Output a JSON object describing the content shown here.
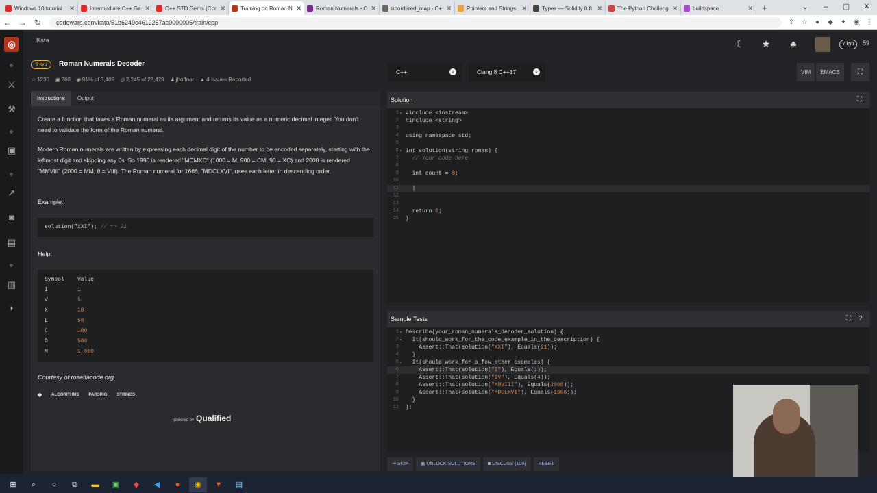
{
  "browser": {
    "tabs": [
      {
        "label": "Windows 10 tutorial",
        "fav_color": "#e02828"
      },
      {
        "label": "Intermediate C++ Ga",
        "fav_color": "#e02828"
      },
      {
        "label": "C++ STD Gems (Cor",
        "fav_color": "#e02828"
      },
      {
        "label": "Training on Roman N",
        "fav_color": "#b1361e",
        "active": true
      },
      {
        "label": "Roman Numerals - O",
        "fav_color": "#7a2a8a"
      },
      {
        "label": "unordered_map - C+",
        "fav_color": "#666"
      },
      {
        "label": "Pointers and Strings",
        "fav_color": "#e9a23b"
      },
      {
        "label": "Types — Solidity 0.8",
        "fav_color": "#444"
      },
      {
        "label": "The Python Challeng",
        "fav_color": "#c44"
      },
      {
        "label": "buildspace",
        "fav_color": "#a64ad0"
      }
    ],
    "new_tab": "+",
    "url": "codewars.com/kata/51b6249c4612257ac0000005/train/cpp"
  },
  "header": {
    "section": "Kata",
    "honor": "59",
    "user_rank": "7 kyu"
  },
  "kata": {
    "rank": "6 kyu",
    "title": "Roman Numerals Decoder",
    "stats": {
      "stars": "1230",
      "collections": "260",
      "satisfaction": "91% of 3,409",
      "completed": "2,245 of 28,479",
      "author": "jhoffner",
      "issues": "4 Issues Reported"
    }
  },
  "description": {
    "tabs": [
      "Instructions",
      "Output"
    ],
    "para1": "Create a function that takes a Roman numeral as its argument and returns its value as a numeric decimal integer. You don't need to validate the form of the Roman numeral.",
    "para2": "Modern Roman numerals are written by expressing each decimal digit of the number to be encoded separately, starting with the leftmost digit and skipping any 0s. So 1990 is rendered \"MCMXC\" (1000 = M, 900 = CM, 90 = XC) and 2008 is rendered \"MMVIII\" (2000 = MM, 8 = VIII). The Roman numeral for 1666, \"MDCLXVI\", uses each letter in descending order.",
    "example_heading": "Example:",
    "example_code": "solution(\"XXI\");",
    "example_comment": "// => 21",
    "help_heading": "Help:",
    "help_table": {
      "headers": [
        "Symbol",
        "Value"
      ],
      "rows": [
        [
          "I",
          "1"
        ],
        [
          "V",
          "5"
        ],
        [
          "X",
          "10"
        ],
        [
          "L",
          "50"
        ],
        [
          "C",
          "100"
        ],
        [
          "D",
          "500"
        ],
        [
          "M",
          "1,000"
        ]
      ]
    },
    "courtesy": "Courtesy of rosettacode.org",
    "tags": [
      "ALGORITHMS",
      "PARSING",
      "STRINGS"
    ],
    "powered_by": "powered by",
    "powered_brand": "Qualified"
  },
  "editor": {
    "language": "C++",
    "version": "Clang 8 C++17",
    "modes": [
      "VIM",
      "EMACS"
    ],
    "solution_title": "Solution",
    "sample_tests_title": "Sample Tests"
  },
  "actions": {
    "skip": "SKIP",
    "unlock": "UNLOCK SOLUTIONS",
    "discuss": "DISCUSS (109)",
    "reset": "RESET"
  }
}
